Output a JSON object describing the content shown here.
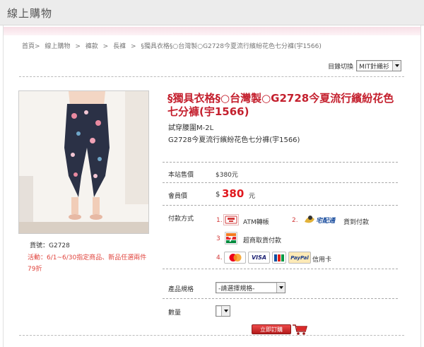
{
  "header": {
    "title": "線上購物"
  },
  "breadcrumb": {
    "items": [
      "首頁>",
      "線上購物",
      ">",
      "褲款",
      ">",
      "長褲",
      ">",
      "§獨具衣格§○台灣製○G2728今夏流行繽紛花色七分褲(宇1566)"
    ]
  },
  "catalog": {
    "label": "目錄切換",
    "selected": "MIT針織衫"
  },
  "product": {
    "image_alt": "floral capri pants",
    "sku_label": "貨號：G2728",
    "promo": "活動：6/1~6/30指定商品、新品任選兩件79折",
    "title": "§獨具衣格§○台灣製○G2728今夏流行繽紛花色七分褲(宇1566)",
    "subtitle1": "試穿腰圍M-2L",
    "subtitle2": "G2728今夏流行繽紛花色七分褲(宇1566)"
  },
  "pricing": {
    "site_price_label": "本站售價",
    "site_price": "$380元",
    "member_price_label": "會員價",
    "member_currency": "$",
    "member_price": "380",
    "member_unit": "元"
  },
  "payment": {
    "label": "付款方式",
    "options": [
      {
        "num": "1.",
        "text": "ATM轉帳"
      },
      {
        "num": "2.",
        "text": "貨到付款"
      },
      {
        "num": "3",
        "text": "超商取貨付款"
      },
      {
        "num": "4.",
        "text": "信用卡"
      }
    ],
    "cards": [
      "MasterCard",
      "VISA",
      "JCB",
      "PayPal"
    ]
  },
  "spec": {
    "label": "產品規格",
    "selected": "-請選擇規格-"
  },
  "quantity": {
    "label": "數量",
    "selected": ""
  },
  "buy": {
    "label": "立即訂購"
  },
  "colors": {
    "accent": "#c4202e",
    "price_red": "#e0181e",
    "promo": "#e0443d"
  }
}
